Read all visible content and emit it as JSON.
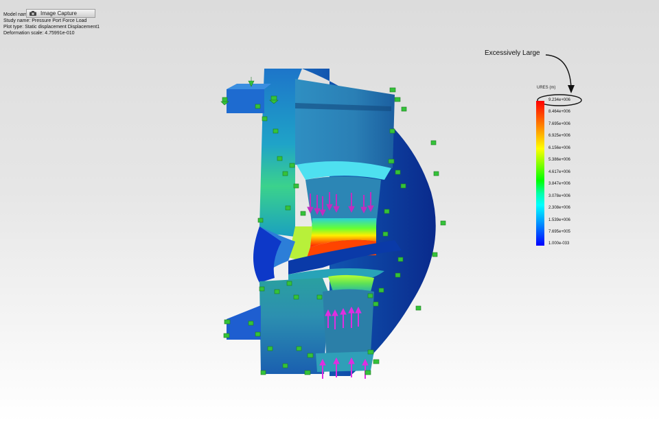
{
  "window": {
    "capture_button_label": "Image Capture"
  },
  "plot_info": {
    "lines": [
      "Model name: ",
      "Study name: Pressure Port Force Load",
      "Plot type: Static displacement Displacement1",
      "Deformation scale: 4.75991e-010"
    ]
  },
  "legend": {
    "title": "URES (m)",
    "labels": [
      "9.234e+006",
      "8.464e+006",
      "7.695e+006",
      "6.925e+006",
      "6.156e+006",
      "5.386e+006",
      "4.617e+006",
      "3.847e+006",
      "3.078e+006",
      "2.308e+006",
      "1.539e+006",
      "7.695e+005",
      "1.000e-033"
    ]
  },
  "annotation": {
    "callout_text": "Excessively Large"
  },
  "icons": {
    "camera": "camera-icon",
    "fixture": "fixture-arrow-icon",
    "force": "force-arrow-icon"
  },
  "colors": {
    "max_displacement": "#ff0000",
    "min_displacement": "#0000ff",
    "fixture_arrows": "#2fb82f",
    "force_arrows": "#d020d0"
  }
}
